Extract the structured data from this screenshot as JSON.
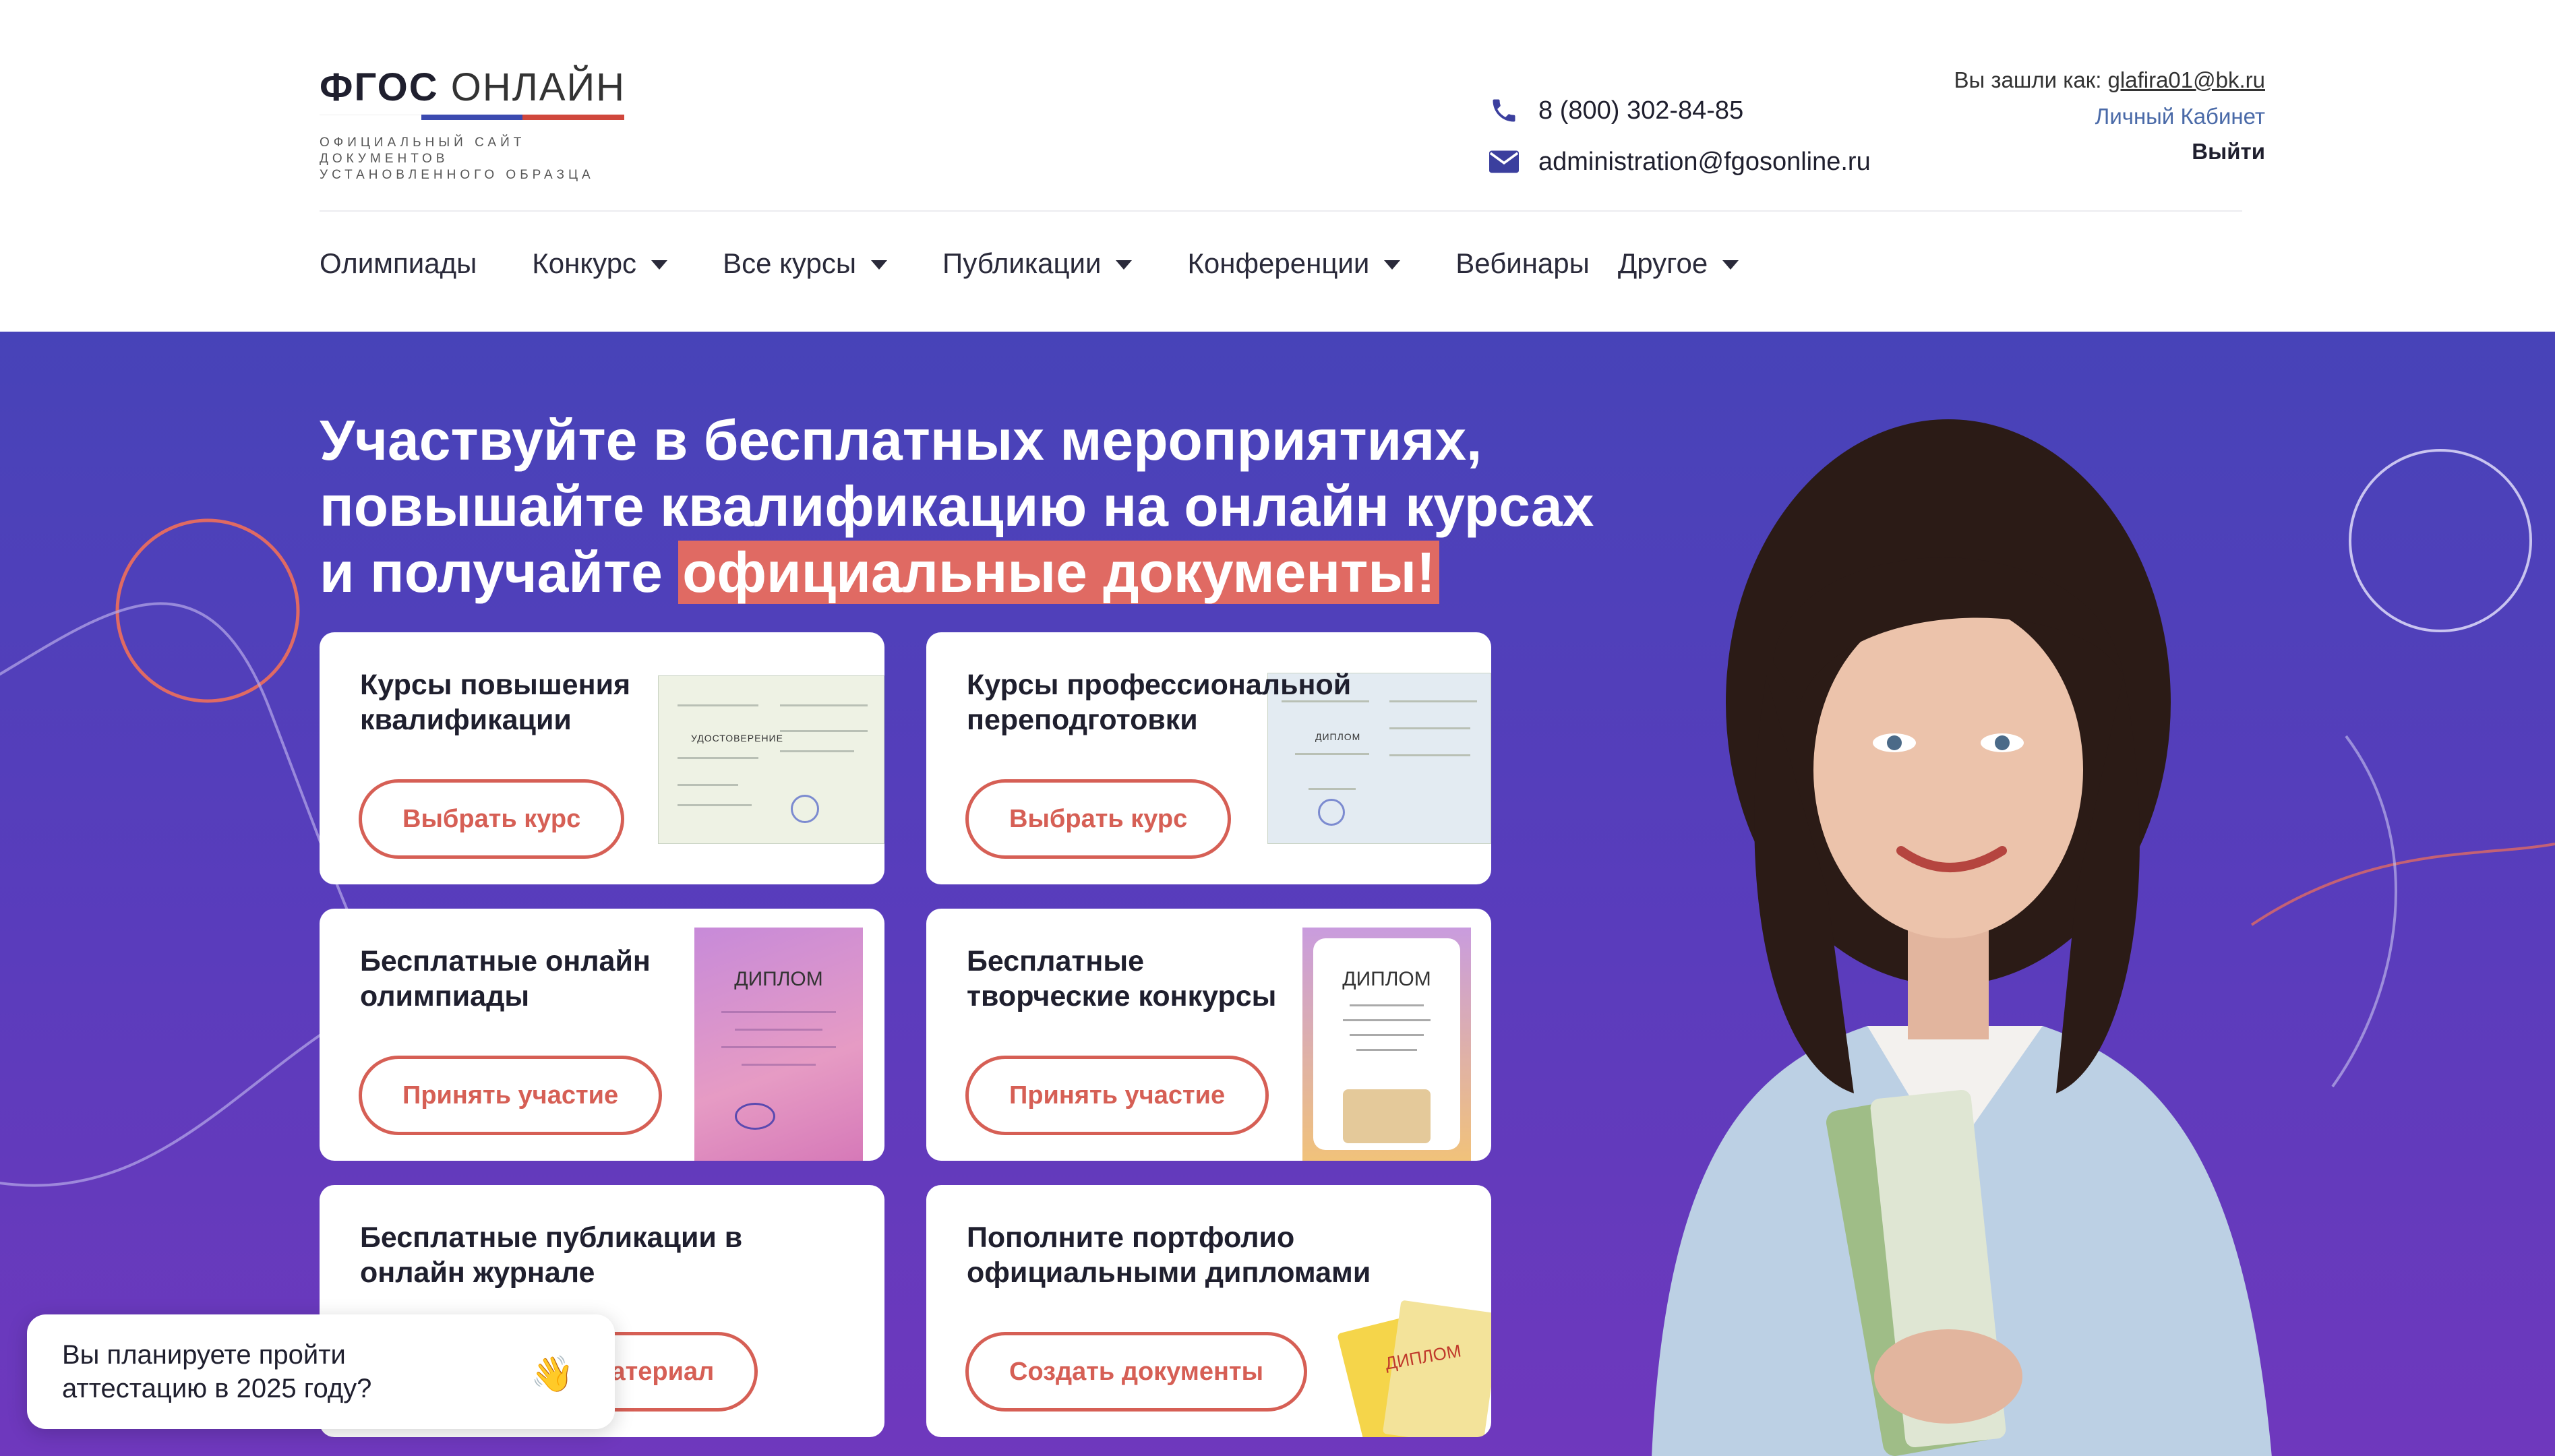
{
  "logo": {
    "title_bold": "ФГОС",
    "title_light": "ОНЛАЙН",
    "subtitle_line1": "официальный сайт документов",
    "subtitle_line2": "установленного образца",
    "stripe_colors": [
      "#ffffff",
      "#3b4ab0",
      "#d0473c"
    ]
  },
  "contact": {
    "phone": "8 (800) 302-84-85",
    "email": "administration@fgosonline.ru",
    "icon_color": "#3b3f9e"
  },
  "account": {
    "label": "Вы зашли как:",
    "user": "glafira01@bk.ru",
    "cabinet": "Личный Кабинет",
    "logout": "Выйти"
  },
  "nav": {
    "items": [
      {
        "label": "Олимпиады",
        "dropdown": false
      },
      {
        "label": "Конкурс",
        "dropdown": true
      },
      {
        "label": "Все курсы",
        "dropdown": true
      },
      {
        "label": "Публикации",
        "dropdown": true
      },
      {
        "label": "Конференции",
        "dropdown": true
      },
      {
        "label": "Вебинары",
        "dropdown": false
      },
      {
        "label": "Другое",
        "dropdown": true
      }
    ]
  },
  "hero": {
    "line1": "Участвуйте в бесплатных мероприятиях,",
    "line2": "повышайте квалификацию на онлайн курсах",
    "line3_prefix": "и получайте ",
    "line3_highlight": "официальные документы!",
    "gradient_top": "#4743b8",
    "gradient_bottom": "#6f38bd",
    "accent": "#d65f55"
  },
  "cards": [
    {
      "title": "Курсы повышения квалификации",
      "button": "Выбрать курс",
      "doc_label": "УДОСТОВЕРЕНИЕ"
    },
    {
      "title": "Курсы профессиональной переподготовки",
      "button": "Выбрать курс",
      "doc_label": "ДИПЛОМ"
    },
    {
      "title": "Бесплатные онлайн олимпиады",
      "button": "Принять участие",
      "doc_label": "ДИПЛОМ"
    },
    {
      "title": "Бесплатные творческие конкурсы",
      "button": "Принять участие",
      "doc_label": "ДИПЛОМ"
    },
    {
      "title": "Бесплатные публикации в онлайн журнале",
      "button": "Опубликовать материал",
      "doc_label": ""
    },
    {
      "title": "Пополните портфолио официальными дипломами",
      "button": "Создать документы",
      "doc_label": "ДИПЛОМ"
    }
  ],
  "chat": {
    "text": "Вы планируете пройти аттестацию в 2025 году?",
    "emoji": "👋"
  }
}
